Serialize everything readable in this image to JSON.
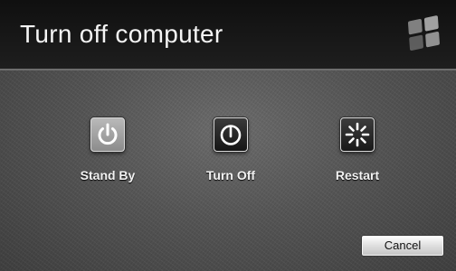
{
  "dialog": {
    "title": "Turn off computer"
  },
  "options": [
    {
      "label": "Stand By",
      "icon": "power-icon"
    },
    {
      "label": "Turn Off",
      "icon": "power-icon"
    },
    {
      "label": "Restart",
      "icon": "restart-icon"
    }
  ],
  "footer": {
    "cancel_label": "Cancel"
  },
  "colors": {
    "title_bar": "#161616",
    "body": "#555555",
    "text": "#f2f2f2"
  }
}
